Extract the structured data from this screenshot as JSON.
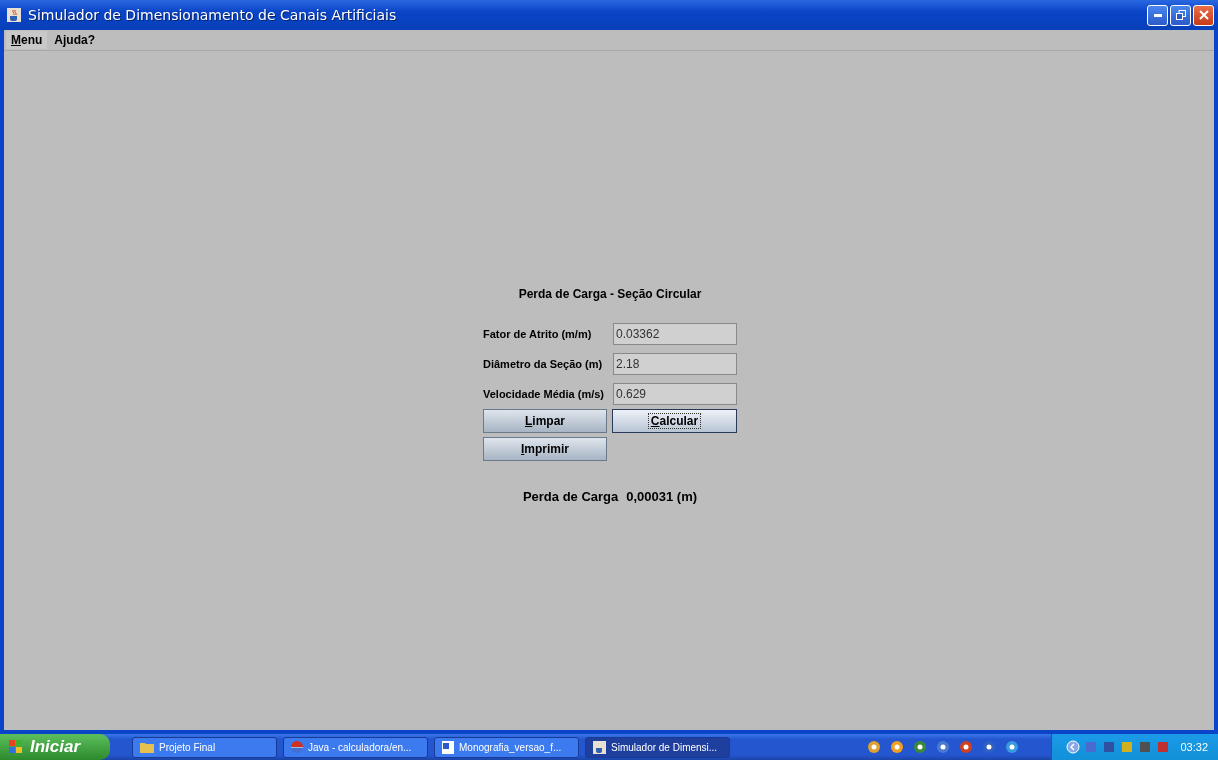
{
  "window": {
    "title": "Simulador de Dimensionamento de Canais Artificiais"
  },
  "menu": [
    {
      "label": "Menu",
      "mnemonic": true
    },
    {
      "label": "Ajuda?",
      "mnemonic": false
    }
  ],
  "form": {
    "title": "Perda de Carga - Seção Circular",
    "fields": [
      {
        "label": "Fator de Atrito (m/m)",
        "value": "0.03362"
      },
      {
        "label": "Diâmetro da Seção (m)",
        "value": "2.18"
      },
      {
        "label": "Velocidade Média (m/s)",
        "value": "0.629"
      }
    ],
    "buttons": [
      {
        "label": "Limpar",
        "mnemonic": true,
        "focused": false
      },
      {
        "label": "Calcular",
        "mnemonic": true,
        "focused": true
      },
      {
        "label": "Imprimir",
        "mnemonic": true,
        "focused": false
      }
    ],
    "result_label": "Perda de Carga",
    "result_value": "0,00031 (m)"
  },
  "taskbar": {
    "start": "Iniciar",
    "tasks": [
      {
        "label": "Projeto Final",
        "selected": false,
        "kind": "folder"
      },
      {
        "label": "Java - calculadora/en...",
        "selected": false,
        "kind": "globe"
      },
      {
        "label": "Monografia_versao_f...",
        "selected": false,
        "kind": "document"
      },
      {
        "label": "Simulador de Dimensi...",
        "selected": true,
        "kind": "java"
      }
    ],
    "clock": "03:32"
  }
}
